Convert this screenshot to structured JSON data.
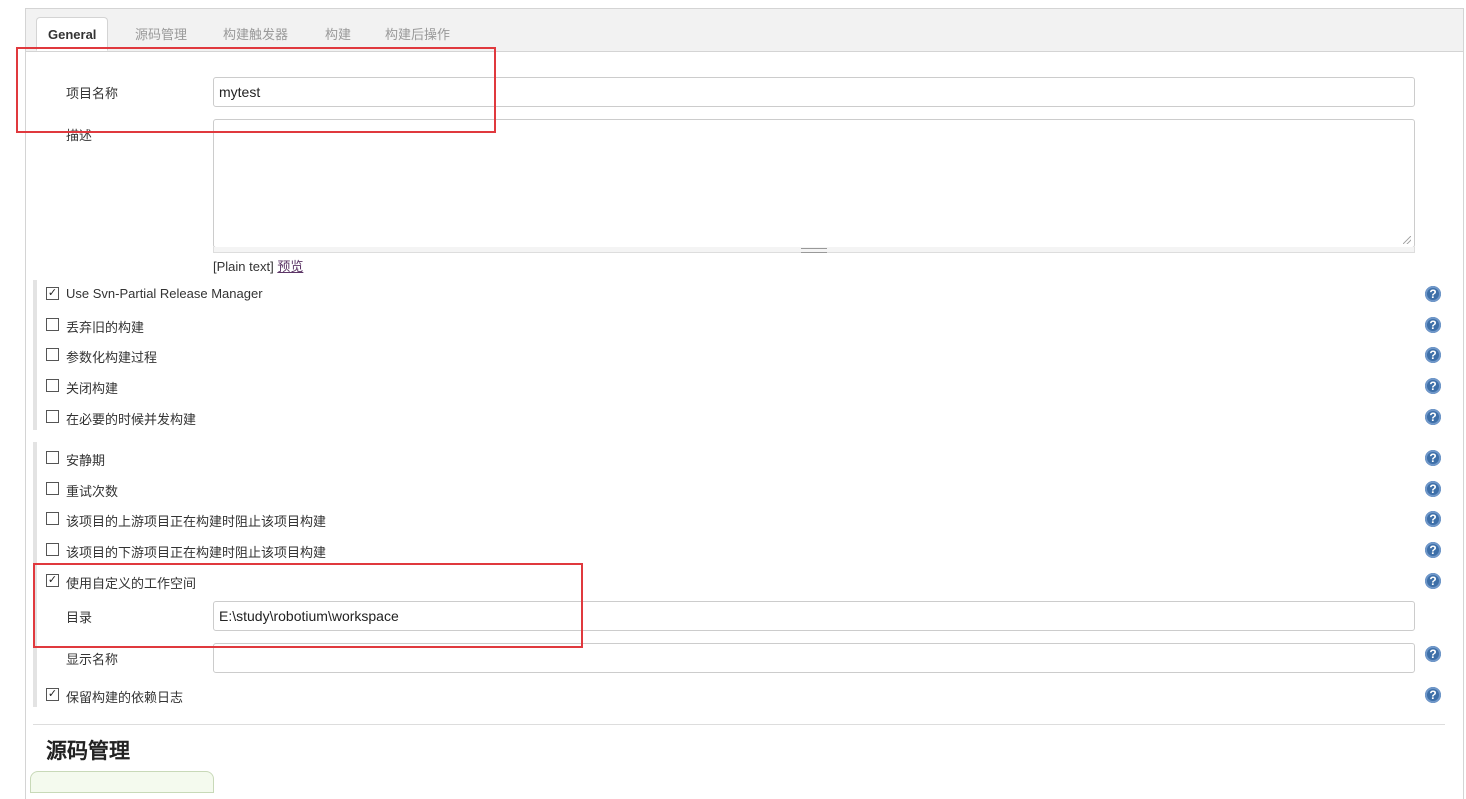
{
  "tabs": [
    {
      "label": "General",
      "active": true
    },
    {
      "label": "源码管理",
      "active": false
    },
    {
      "label": "构建触发器",
      "active": false
    },
    {
      "label": "构建",
      "active": false
    },
    {
      "label": "构建后操作",
      "active": false
    }
  ],
  "general": {
    "project_name_label": "项目名称",
    "project_name_value": "mytest",
    "description_label": "描述",
    "syntax_prefix": "[Plain text]",
    "preview_link": "预览",
    "options_group1": [
      {
        "label": "Use Svn-Partial Release Manager",
        "checked": true
      },
      {
        "label": "丢弃旧的构建",
        "checked": false
      },
      {
        "label": "参数化构建过程",
        "checked": false
      },
      {
        "label": "关闭构建",
        "checked": false
      },
      {
        "label": "在必要的时候并发构建",
        "checked": false
      }
    ],
    "options_group2": [
      {
        "label": "安静期",
        "checked": false
      },
      {
        "label": "重试次数",
        "checked": false
      },
      {
        "label": "该项目的上游项目正在构建时阻止该项目构建",
        "checked": false
      },
      {
        "label": "该项目的下游项目正在构建时阻止该项目构建",
        "checked": false
      },
      {
        "label": "使用自定义的工作空间",
        "checked": true
      }
    ],
    "directory_label": "目录",
    "directory_value": "E:\\study\\robotium\\workspace",
    "display_name_label": "显示名称",
    "display_name_value": "",
    "keep_deps_label": "保留构建的依赖日志",
    "keep_deps_checked": true
  },
  "scm_section_title": "源码管理",
  "colors": {
    "highlight_box": "#e0393e",
    "help_icon": "#3d6fa8",
    "link": "#5c3566"
  },
  "icons": {
    "help": "question-mark-circle",
    "check": "✓"
  }
}
